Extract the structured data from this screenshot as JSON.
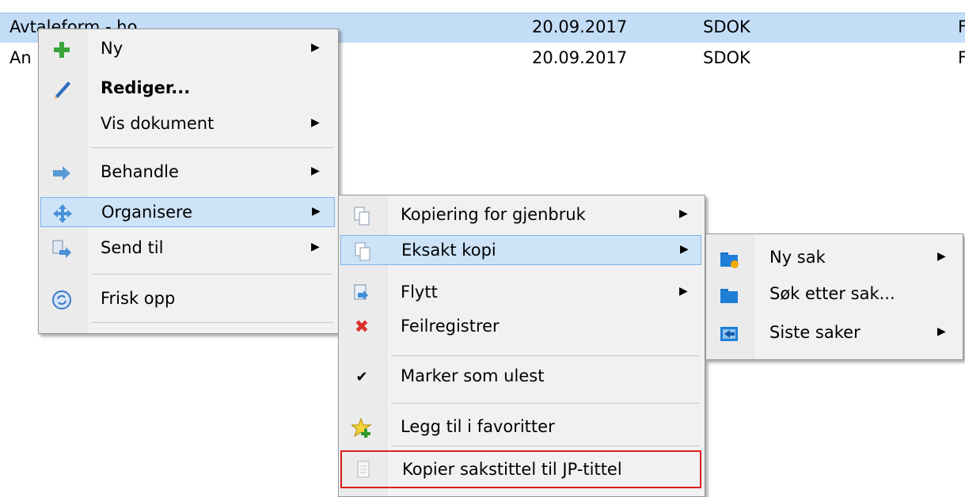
{
  "list": {
    "rows": [
      {
        "name": "Avtaleform - ho",
        "date": "20.09.2017",
        "type": "SDOK",
        "extra": "F"
      },
      {
        "name": "An",
        "date": "20.09.2017",
        "type": "SDOK",
        "extra": "F"
      }
    ]
  },
  "menu1": {
    "ny": "Ny",
    "rediger": "Rediger...",
    "vis_dokument": "Vis dokument",
    "behandle": "Behandle",
    "organisere": "Organisere",
    "send_til": "Send til",
    "frisk_opp": "Frisk opp"
  },
  "menu2": {
    "kopiering": "Kopiering for gjenbruk",
    "eksakt_kopi": "Eksakt kopi",
    "flytt": "Flytt",
    "feilregistrer": "Feilregistrer",
    "marker_ulest": "Marker som ulest",
    "favoritter": "Legg til i favoritter",
    "kopier_sakstittel": "Kopier sakstittel til JP-tittel"
  },
  "menu3": {
    "ny_sak": "Ny sak",
    "sok_sak": "Søk etter sak...",
    "siste_saker": "Siste saker"
  },
  "icons": {
    "arrow": "▶",
    "check": "✔",
    "cross": "✖"
  },
  "colors": {
    "highlight": "#cde4f8",
    "highlight_border": "#80b3e8",
    "selected_row": "#c3ddf7",
    "red_outline": "#e01b1b"
  }
}
